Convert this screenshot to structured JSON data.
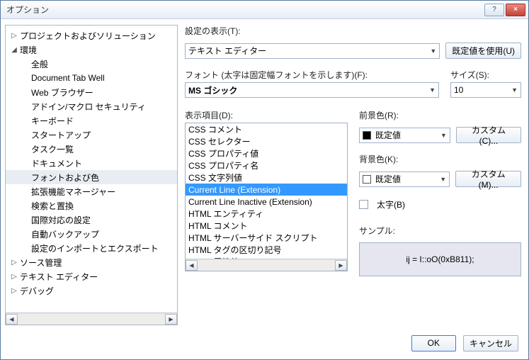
{
  "window": {
    "title": "オプション"
  },
  "labels": {
    "show_settings": "設定の表示(T):",
    "use_default": "既定値を使用(U)",
    "font": "フォント (太字は固定幅フォントを示します)(F):",
    "size": "サイズ(S):",
    "display_items": "表示項目(D):",
    "foreground": "前景色(R):",
    "background": "背景色(K):",
    "custom_c": "カスタム(C)...",
    "custom_m": "カスタム(M)...",
    "bold": "太字(B)",
    "sample": "サンプル:"
  },
  "settings_for": "テキスト エディター",
  "font_value": "MS ゴシック",
  "size_value": "10",
  "fg_value": "既定値",
  "bg_value": "既定値",
  "fg_swatch": "#000000",
  "bg_swatch": "#ffffff",
  "sample_text": "ij = I::oO(0xB811);",
  "buttons": {
    "ok": "OK",
    "cancel": "キャンセル"
  },
  "tree": [
    {
      "depth": 1,
      "tw": "▷",
      "label": "プロジェクトおよびソリューション"
    },
    {
      "depth": 1,
      "tw": "◢",
      "label": "環境"
    },
    {
      "depth": 2,
      "label": "全般"
    },
    {
      "depth": 2,
      "label": "Document Tab Well"
    },
    {
      "depth": 2,
      "label": "Web ブラウザー"
    },
    {
      "depth": 2,
      "label": "アドイン/マクロ セキュリティ"
    },
    {
      "depth": 2,
      "label": "キーボード"
    },
    {
      "depth": 2,
      "label": "スタートアップ"
    },
    {
      "depth": 2,
      "label": "タスク一覧"
    },
    {
      "depth": 2,
      "label": "ドキュメント"
    },
    {
      "depth": 2,
      "label": "フォントおよび色",
      "sel": true
    },
    {
      "depth": 2,
      "label": "拡張機能マネージャー"
    },
    {
      "depth": 2,
      "label": "検索と置換"
    },
    {
      "depth": 2,
      "label": "国際対応の設定"
    },
    {
      "depth": 2,
      "label": "自動バックアップ"
    },
    {
      "depth": 2,
      "label": "設定のインポートとエクスポート"
    },
    {
      "depth": 1,
      "tw": "▷",
      "label": "ソース管理"
    },
    {
      "depth": 1,
      "tw": "▷",
      "label": "テキスト エディター"
    },
    {
      "depth": 1,
      "tw": "▷",
      "label": "デバッグ"
    }
  ],
  "list_items": [
    {
      "label": "CSS コメント"
    },
    {
      "label": "CSS セレクター"
    },
    {
      "label": "CSS プロパティ値"
    },
    {
      "label": "CSS プロパティ名"
    },
    {
      "label": "CSS 文字列値"
    },
    {
      "label": "Current Line (Extension)",
      "sel": true
    },
    {
      "label": "Current Line Inactive (Extension)"
    },
    {
      "label": "HTML エンティティ"
    },
    {
      "label": "HTML コメント"
    },
    {
      "label": "HTML サーバーサイド スクリプト"
    },
    {
      "label": "HTML タグの区切り記号"
    },
    {
      "label": "HTML 属性値"
    }
  ]
}
